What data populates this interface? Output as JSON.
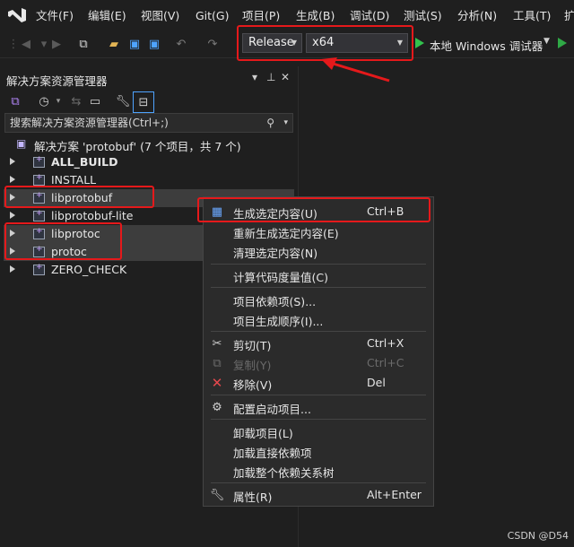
{
  "menu": [
    "文件(F)",
    "编辑(E)",
    "视图(V)",
    "Git(G)",
    "项目(P)",
    "生成(B)",
    "调试(D)",
    "测试(S)",
    "分析(N)",
    "工具(T)",
    "扩"
  ],
  "toolbar": {
    "config": "Release",
    "platform": "x64",
    "run_label": "本地 Windows 调试器"
  },
  "solution_explorer": {
    "title": "解决方案资源管理器",
    "search_placeholder": "搜索解决方案资源管理器(Ctrl+;)",
    "solution_label": "解决方案 'protobuf' (7 个项目，共 7 个)",
    "projects": [
      "ALL_BUILD",
      "INSTALL",
      "libprotobuf",
      "libprotobuf-lite",
      "libprotoc",
      "protoc",
      "ZERO_CHECK"
    ]
  },
  "context_menu": {
    "items": [
      {
        "label": "生成选定内容(U)",
        "shortcut": "Ctrl+B",
        "icon": "build-icon"
      },
      {
        "label": "重新生成选定内容(E)",
        "shortcut": ""
      },
      {
        "label": "清理选定内容(N)",
        "shortcut": ""
      },
      {
        "label": "计算代码度量值(C)",
        "shortcut": ""
      },
      {
        "label": "项目依赖项(S)...",
        "shortcut": ""
      },
      {
        "label": "项目生成顺序(I)...",
        "shortcut": ""
      },
      {
        "label": "剪切(T)",
        "shortcut": "Ctrl+X",
        "icon": "scissors-icon"
      },
      {
        "label": "复制(Y)",
        "shortcut": "Ctrl+C",
        "icon": "copy-icon",
        "disabled": true
      },
      {
        "label": "移除(V)",
        "shortcut": "Del",
        "icon": "remove-icon"
      },
      {
        "label": "配置启动项目...",
        "shortcut": "",
        "icon": "gear-icon"
      },
      {
        "label": "卸载项目(L)",
        "shortcut": ""
      },
      {
        "label": "加载直接依赖项",
        "shortcut": ""
      },
      {
        "label": "加载整个依赖关系树",
        "shortcut": ""
      },
      {
        "label": "属性(R)",
        "shortcut": "Alt+Enter",
        "icon": "wrench-icon"
      }
    ]
  },
  "watermark": "CSDN @D54",
  "colors": {
    "accent": "#e5191b",
    "run": "#32c24d"
  }
}
